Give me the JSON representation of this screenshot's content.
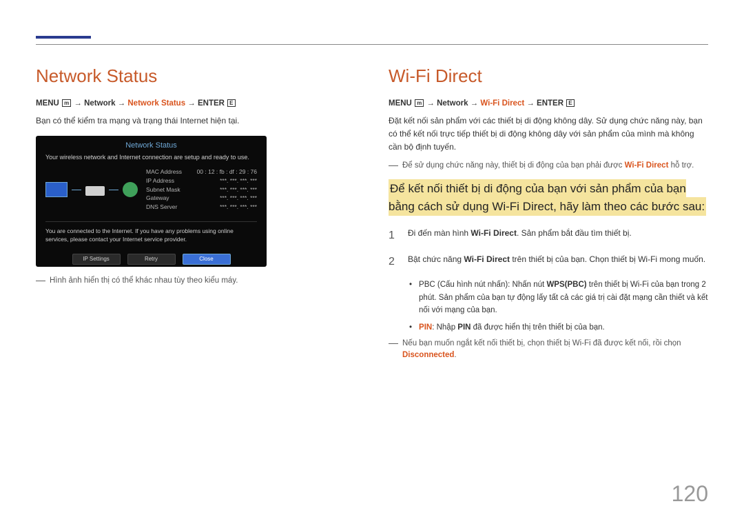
{
  "left": {
    "heading": "Network Status",
    "menu": {
      "prefix": "MENU",
      "icon1": "m",
      "path1": " → Network → ",
      "highlight": "Network Status",
      "path2": " → ENTER",
      "icon2": "E"
    },
    "intro": "Bạn có thể kiểm tra mạng và trạng thái Internet hiện tại.",
    "screenshot": {
      "title": "Network Status",
      "readyMsg": "Your wireless network and Internet connection are setup and ready to use.",
      "fields": [
        {
          "label": "MAC Address",
          "value": "00 : 12 : fb : df : 29 : 76"
        },
        {
          "label": "IP Address",
          "value": "***. ***. ***. ***"
        },
        {
          "label": "Subnet Mask",
          "value": "***. ***. ***. ***"
        },
        {
          "label": "Gateway",
          "value": "***. ***. ***. ***"
        },
        {
          "label": "DNS Server",
          "value": "***. ***. ***. ***"
        }
      ],
      "footer": "You are connected to the Internet. If you have any problems using online services, please contact your Internet service provider.",
      "buttons": [
        "IP Settings",
        "Retry",
        "Close"
      ]
    },
    "note": "Hình ảnh hiển thị có thể khác nhau tùy theo kiểu máy."
  },
  "right": {
    "heading": "Wi-Fi Direct",
    "menu": {
      "prefix": "MENU",
      "icon1": "m",
      "path1": " → Network → ",
      "highlight": "Wi-Fi Direct",
      "path2": " → ENTER",
      "icon2": "E"
    },
    "intro": "Đặt kết nối sản phẩm với các thiết bị di động không dây. Sử dụng chức năng này, bạn có thể kết nối trực tiếp thiết bị di động không dây với sản phẩm của mình mà không cần bộ định tuyến.",
    "note1_a": "Để sử dụng chức năng này, thiết bị di động của bạn phải được ",
    "note1_b": "Wi-Fi Direct",
    "note1_c": " hỗ trợ.",
    "highlight": "Để kết nối thiết bị di động của bạn với sản phẩm của bạn bằng cách sử dụng  Wi-Fi Direct, hãy làm theo các bước sau:",
    "step1_a": "Đi đến màn hình ",
    "step1_b": "Wi-Fi Direct",
    "step1_c": ". Sản phẩm bắt đầu tìm thiết bị.",
    "step2_a": "Bật chức năng ",
    "step2_b": "Wi-Fi Direct",
    "step2_c": " trên thiết bị của bạn. Chọn thiết bị Wi-Fi mong muốn.",
    "bullet1_a": "PBC (Cấu hình nút nhấn): Nhấn nút ",
    "bullet1_b": "WPS(PBC)",
    "bullet1_c": " trên thiết bị Wi-Fi của bạn trong 2 phút. Sản phẩm của bạn tự động lấy tất cả các giá trị cài đặt mạng cần thiết và kết nối với mạng của bạn.",
    "bullet2_a": "PIN",
    "bullet2_b": ": Nhập ",
    "bullet2_c": "PIN",
    "bullet2_d": " đã được hiển thị trên thiết bị của bạn.",
    "note2_a": "Nếu bạn muốn ngắt kết nối thiết bị, chọn thiết bị Wi-Fi đã được kết nối, rồi chọn ",
    "note2_b": "Disconnected",
    "note2_c": "."
  },
  "pageNumber": "120"
}
